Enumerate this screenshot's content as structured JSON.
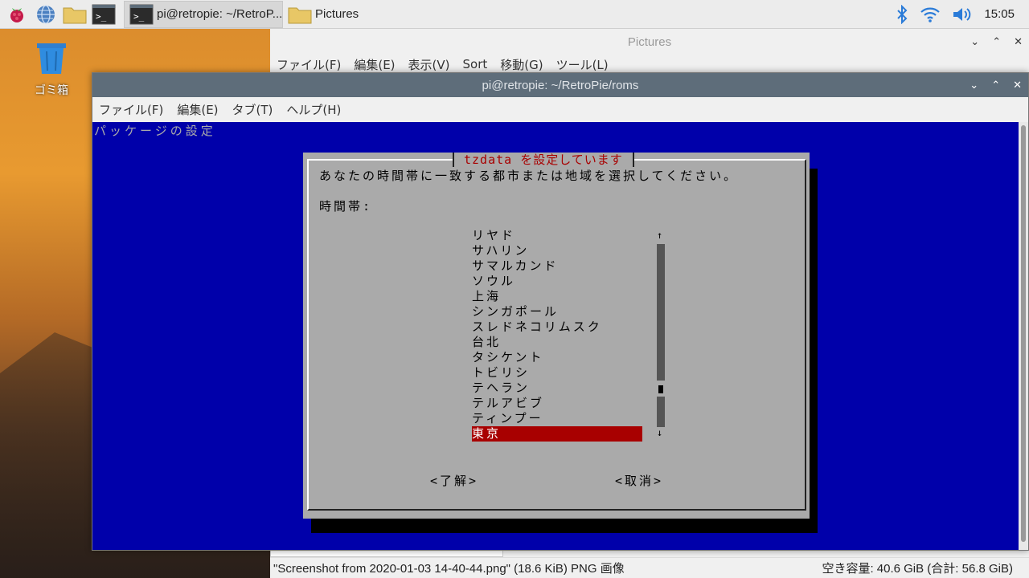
{
  "taskbar": {
    "tasks": [
      {
        "label": "pi@retropie: ~/RetroP...",
        "active": true
      },
      {
        "label": "Pictures",
        "active": false
      }
    ],
    "clock": "15:05"
  },
  "desktop": {
    "trash_label": "ゴミ箱"
  },
  "file_manager": {
    "title": "Pictures",
    "menu": [
      "ファイル(F)",
      "編集(E)",
      "表示(V)",
      "Sort",
      "移動(G)",
      "ツール(L)"
    ],
    "status_left": "\"Screenshot from 2020-01-03 14-40-44.png\" (18.6 KiB) PNG 画像",
    "status_right": "空き容量: 40.6 GiB (合計: 56.8 GiB)"
  },
  "terminal": {
    "title": "pi@retropie: ~/RetroPie/roms",
    "menu": [
      "ファイル(F)",
      "編集(E)",
      "タブ(T)",
      "ヘルプ(H)"
    ],
    "header": "パッケージの設定"
  },
  "dialog": {
    "title": "tzdata を設定しています",
    "prompt": "あなたの時間帯に一致する都市または地域を選択してください。",
    "label": "時間帯:",
    "options": [
      "リヤド",
      "サハリン",
      "サマルカンド",
      "ソウル",
      "上海",
      "シンガポール",
      "スレドネコリムスク",
      "台北",
      "タシケント",
      "トビリシ",
      "テヘラン",
      "テルアビブ",
      "ティンプー",
      "東京"
    ],
    "selected_index": 13,
    "scroll_up": "↑",
    "scroll_down": "↓",
    "ok_label": "<了解>",
    "cancel_label": "<取消>"
  }
}
